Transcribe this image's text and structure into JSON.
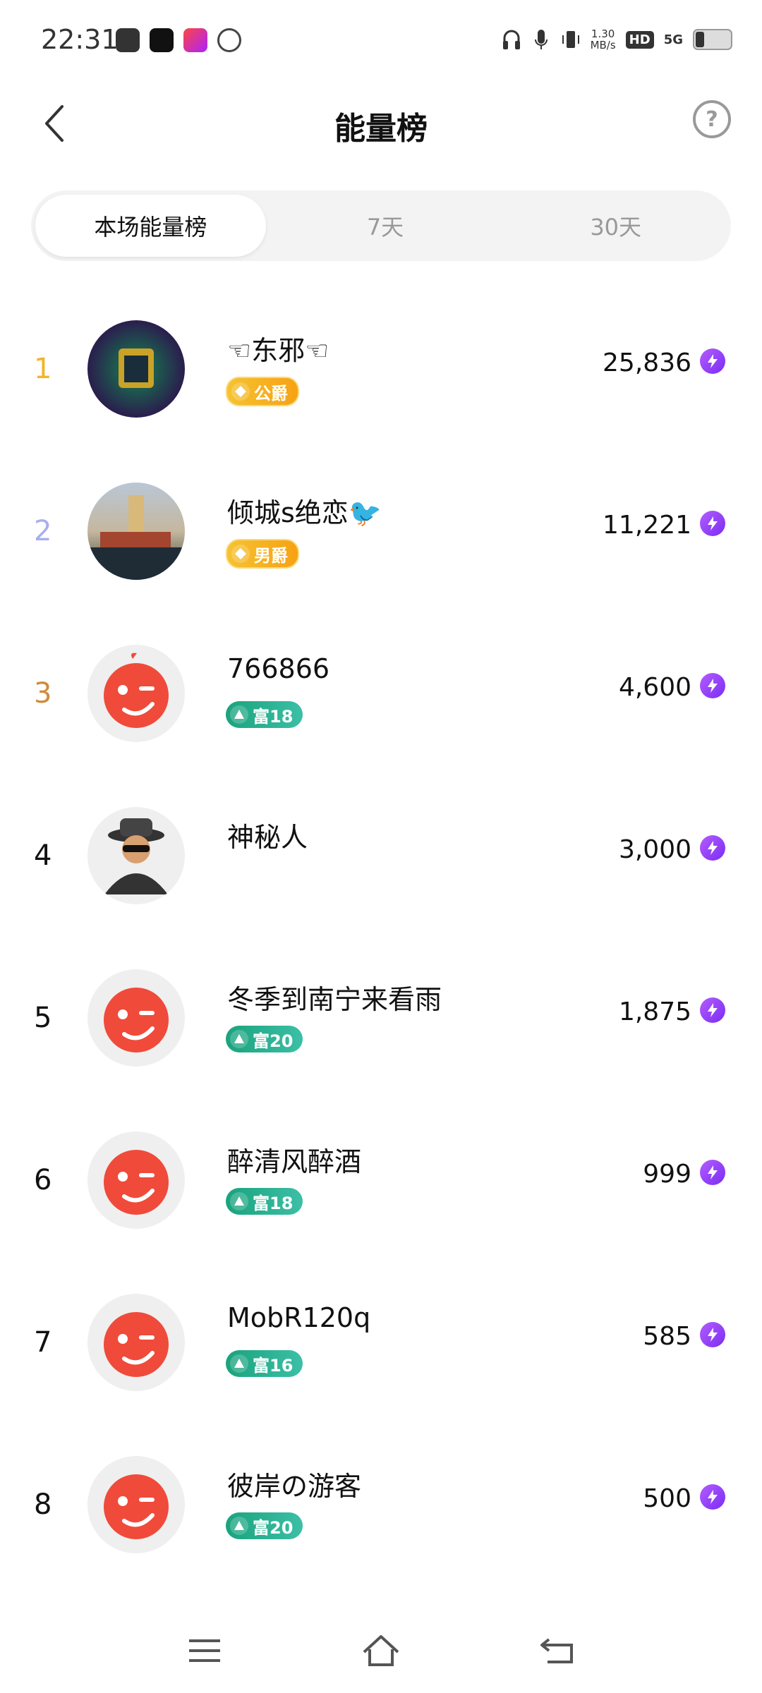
{
  "status_bar": {
    "time": "22:31",
    "net_speed_value": "1.30",
    "net_speed_unit": "MB/s",
    "hd_label": "HD",
    "network_label": "5G"
  },
  "header": {
    "title": "能量榜",
    "help_label": "?"
  },
  "tabs": [
    {
      "label": "本场能量榜",
      "active": true
    },
    {
      "label": "7天",
      "active": false
    },
    {
      "label": "30天",
      "active": false
    }
  ],
  "ranking": [
    {
      "rank": "1",
      "name": "☜东邪☜",
      "badge": "公爵",
      "badge_type": "gold",
      "score": "25,836"
    },
    {
      "rank": "2",
      "name": "倾城s绝恋🐦",
      "badge": "男爵",
      "badge_type": "gold",
      "score": "11,221"
    },
    {
      "rank": "3",
      "name": "766866",
      "badge": "富18",
      "badge_type": "green",
      "score": "4,600"
    },
    {
      "rank": "4",
      "name": "神秘人",
      "badge": "",
      "badge_type": "none",
      "score": "3,000"
    },
    {
      "rank": "5",
      "name": "冬季到南宁来看雨",
      "badge": "富20",
      "badge_type": "green",
      "score": "1,875"
    },
    {
      "rank": "6",
      "name": "醉清风醉酒",
      "badge": "富18",
      "badge_type": "green",
      "score": "999"
    },
    {
      "rank": "7",
      "name": "MobR120q",
      "badge": "富16",
      "badge_type": "green",
      "score": "585"
    },
    {
      "rank": "8",
      "name": "彼岸の游客",
      "badge": "富20",
      "badge_type": "green",
      "score": "500"
    }
  ],
  "colors": {
    "rank1": "#f3b42b",
    "rank2": "#a8aef0",
    "rank3": "#d08a3c",
    "energy": "#8a3bf5",
    "wealth_badge": "#1aa37d",
    "noble_badge": "#f6b21e"
  }
}
